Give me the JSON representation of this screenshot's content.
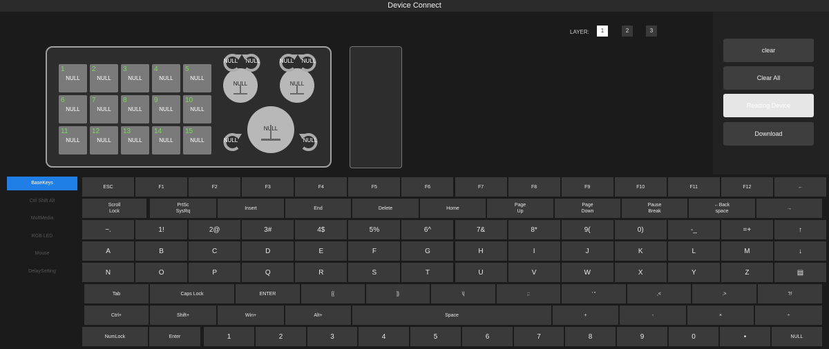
{
  "window": {
    "title": "Device Connect"
  },
  "layers": {
    "label": "LAYER:",
    "items": [
      "1",
      "2",
      "3"
    ],
    "active": "1"
  },
  "device": {
    "keys": [
      {
        "num": "1",
        "label": "NULL"
      },
      {
        "num": "2",
        "label": "NULL"
      },
      {
        "num": "3",
        "label": "NULL"
      },
      {
        "num": "4",
        "label": "NULL"
      },
      {
        "num": "5",
        "label": "NULL"
      },
      {
        "num": "6",
        "label": "NULL"
      },
      {
        "num": "7",
        "label": "NULL"
      },
      {
        "num": "8",
        "label": "NULL"
      },
      {
        "num": "9",
        "label": "NULL"
      },
      {
        "num": "10",
        "label": "NULL"
      },
      {
        "num": "11",
        "label": "NULL"
      },
      {
        "num": "12",
        "label": "NULL"
      },
      {
        "num": "13",
        "label": "NULL"
      },
      {
        "num": "14",
        "label": "NULL"
      },
      {
        "num": "15",
        "label": "NULL"
      }
    ],
    "knobs": [
      {
        "label": "NULL"
      },
      {
        "label": "NULL"
      },
      {
        "label": "NULL"
      }
    ],
    "rotations": [
      {
        "label": "NULL"
      },
      {
        "label": "NULL"
      },
      {
        "label": "NULL"
      },
      {
        "label": "NULL"
      },
      {
        "label": "NULL"
      },
      {
        "label": "NULL"
      }
    ]
  },
  "actions": {
    "clear": "clear",
    "clear_all": "Clear All",
    "reading": "Reading Device",
    "download": "Download"
  },
  "sidebar": {
    "items": [
      "BaseKeys",
      "Ctrl Shift Alt",
      "MultMedia",
      "RGB LED",
      "Mouse",
      "DelaySetting"
    ],
    "active": 0
  },
  "keyboard": {
    "rows": [
      [
        "ESC",
        "F1",
        "F2",
        "F3",
        "F4",
        "F5",
        "F6",
        "F7",
        "F8",
        "F9",
        "F10",
        "F11",
        "F12",
        "←"
      ],
      [
        "Scroll\nLock",
        "PrtSc\nSysRq",
        "Insert",
        "End",
        "Delete",
        "Home",
        "Page\nUp",
        "Page\nDown",
        "Pause\nBreak",
        "←Back\nspace",
        "→"
      ],
      [
        "~.",
        "1!",
        "2@",
        "3#",
        "4$",
        "5%",
        "6^",
        "7&",
        "8*",
        "9(",
        "0)",
        "-_",
        "=+",
        "↑"
      ],
      [
        "A",
        "B",
        "C",
        "D",
        "E",
        "F",
        "G",
        "H",
        "I",
        "J",
        "K",
        "L",
        "M",
        "↓"
      ],
      [
        "N",
        "O",
        "P",
        "Q",
        "R",
        "S",
        "T",
        "U",
        "V",
        "W",
        "X",
        "Y",
        "Z",
        "▤"
      ],
      [
        "Tab",
        "Caps Lock",
        "ENTER",
        "[{",
        "]}",
        "\\|",
        ";:",
        "' \"",
        ",<",
        ".>",
        "?/"
      ],
      [
        "Ctrl+",
        "Shift+",
        "Win+",
        "Alt+",
        "Space",
        "+",
        "-",
        "×",
        "÷"
      ],
      [
        "NumLock",
        "Enter",
        "1",
        "2",
        "3",
        "4",
        "5",
        "6",
        "7",
        "8",
        "9",
        "0",
        "•",
        "NULL"
      ]
    ]
  },
  "colors": {
    "accent": "#1f7fe6",
    "keycap_green": "#7bd85d",
    "background": "#1b1b1b",
    "key": "#3a3a3a"
  }
}
